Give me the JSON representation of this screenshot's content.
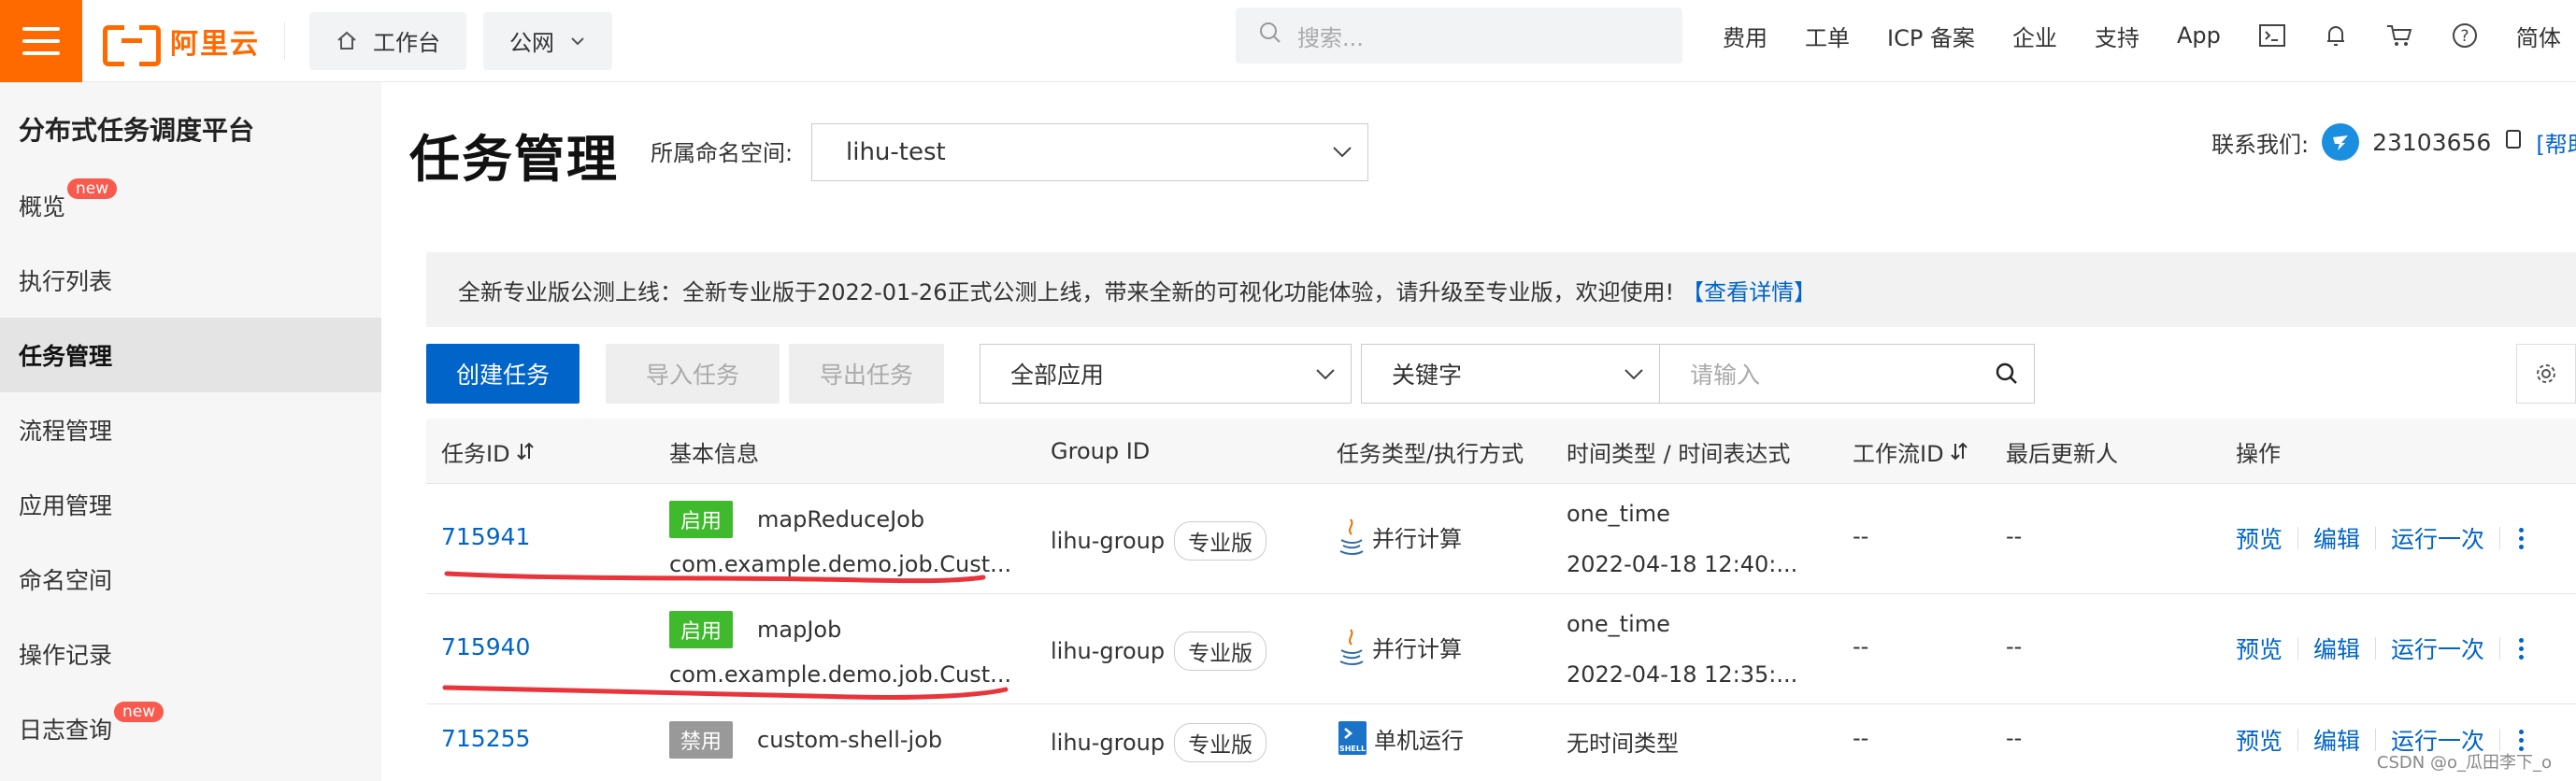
{
  "topbar": {
    "brand": "阿里云",
    "workbench_label": "工作台",
    "network_label": "公网",
    "search_placeholder": "搜索...",
    "nav": [
      "费用",
      "工单",
      "ICP 备案",
      "企业",
      "支持",
      "App"
    ],
    "lang": "简体"
  },
  "sidebar": {
    "title": "分布式任务调度平台",
    "new_badge": "new",
    "items": [
      {
        "label": "概览",
        "badge": true
      },
      {
        "label": "执行列表"
      },
      {
        "label": "任务管理",
        "active": true
      },
      {
        "label": "流程管理"
      },
      {
        "label": "应用管理"
      },
      {
        "label": "命名空间"
      },
      {
        "label": "操作记录"
      },
      {
        "label": "日志查询",
        "badge": true
      }
    ]
  },
  "header": {
    "title": "任务管理",
    "namespace_label": "所属命名空间:",
    "namespace_value": "lihu-test",
    "contact_label": "联系我们:",
    "contact_number": "23103656",
    "help_link": "[帮助"
  },
  "banner": {
    "text": "全新专业版公测上线：全新专业版于2022-01-26正式公测上线，带来全新的可视化功能体验，请升级至专业版，欢迎使用!",
    "link": "【查看详情】"
  },
  "toolbar": {
    "create": "创建任务",
    "import": "导入任务",
    "export": "导出任务",
    "app_filter": "全部应用",
    "keyword_filter": "关键字",
    "keyword_placeholder": "请输入"
  },
  "table": {
    "columns": [
      "任务ID",
      "基本信息",
      "Group ID",
      "任务类型/执行方式",
      "时间类型 / 时间表达式",
      "工作流ID",
      "最后更新人",
      "操作"
    ],
    "rows": [
      {
        "id": "715941",
        "status": "启用",
        "name": "mapReduceJob",
        "class": "com.example.demo.job.Cust...",
        "group": "lihu-group",
        "edition": "专业版",
        "exec": "并行计算",
        "time_type": "one_time",
        "time_expr": "2022-04-18 12:40:...",
        "workflow": "--",
        "updater": "--"
      },
      {
        "id": "715940",
        "status": "启用",
        "name": "mapJob",
        "class": "com.example.demo.job.Cust...",
        "group": "lihu-group",
        "edition": "专业版",
        "exec": "并行计算",
        "time_type": "one_time",
        "time_expr": "2022-04-18 12:35:...",
        "workflow": "--",
        "updater": "--"
      },
      {
        "id": "715255",
        "status": "禁用",
        "name": "custom-shell-job",
        "group": "lihu-group",
        "edition": "专业版",
        "exec": "单机运行",
        "time_type": "无时间类型",
        "workflow": "--",
        "updater": "--"
      }
    ],
    "actions": {
      "preview": "预览",
      "edit": "编辑",
      "run_once": "运行一次"
    }
  },
  "watermark": "CSDN @o_瓜田李下_o",
  "colors": {
    "brand": "#ff6a00",
    "primary": "#0064c8",
    "enabled": "#3fba2d",
    "disabled": "#999999",
    "annotation": "#e8343a"
  }
}
